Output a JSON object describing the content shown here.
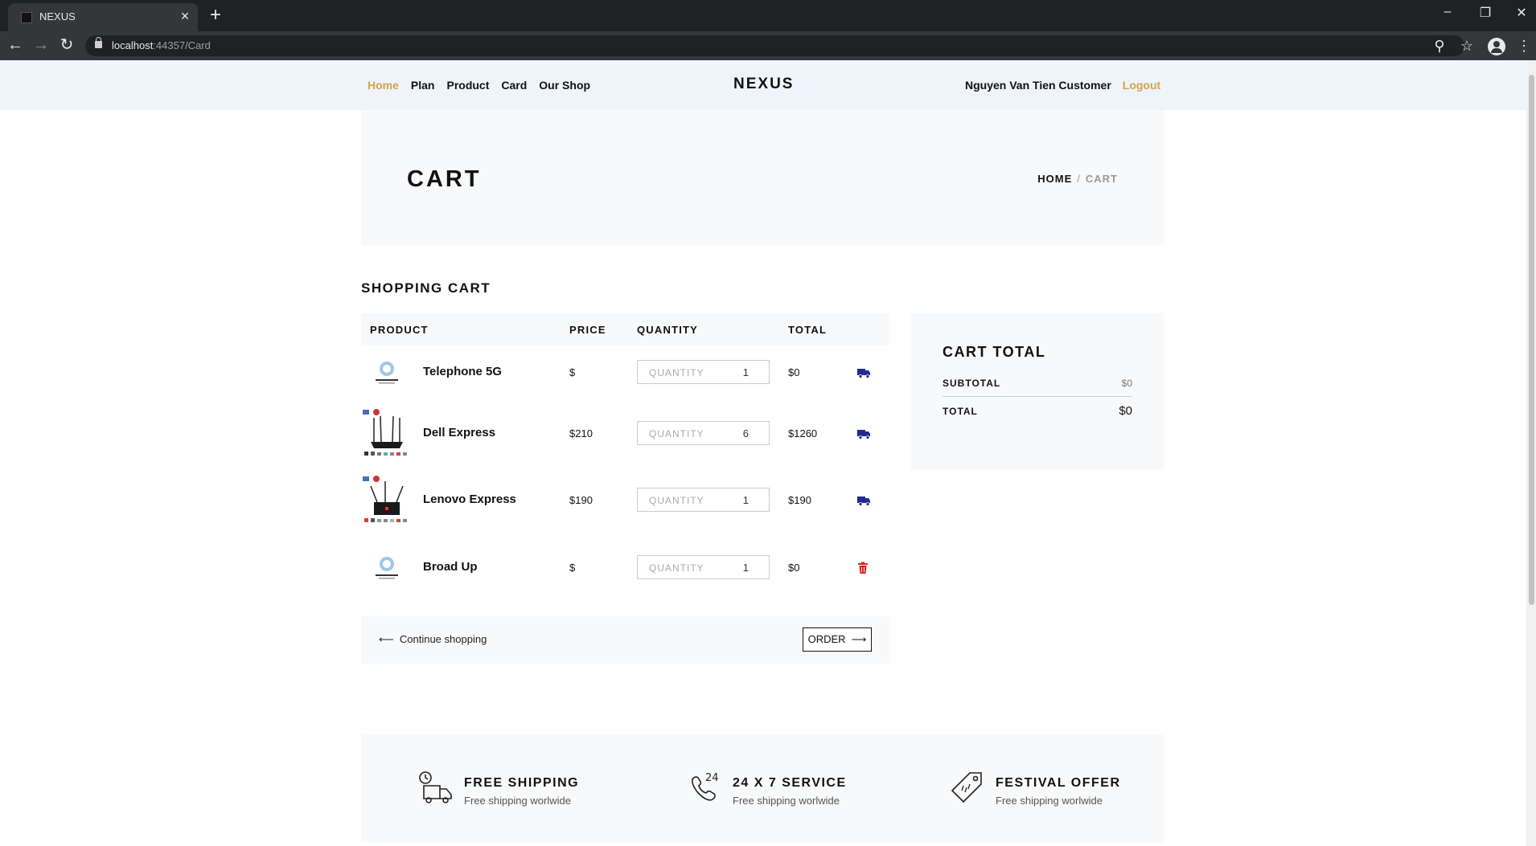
{
  "browser": {
    "tab_title": "NEXUS",
    "url_host": "localhost",
    "url_path": ":44357/Card"
  },
  "nav": {
    "items": [
      "Home",
      "Plan",
      "Product",
      "Card",
      "Our Shop"
    ],
    "logo": "NEXUS",
    "user": "Nguyen Van Tien Customer",
    "logout": "Logout"
  },
  "hero": {
    "title": "CART",
    "breadcrumb_home": "HOME",
    "breadcrumb_sep": "/",
    "breadcrumb_current": "CART"
  },
  "cart": {
    "title": "SHOPPING CART",
    "headers": {
      "product": "PRODUCT",
      "price": "PRICE",
      "quantity": "QUANTITY",
      "total": "TOTAL"
    },
    "qty_placeholder": "QUANTITY",
    "rows": [
      {
        "name": "Telephone 5G",
        "price": "$",
        "qty": "1",
        "total": "$0",
        "action_icon": "truck-icon",
        "image": "logo-thumb"
      },
      {
        "name": "Dell Express",
        "price": "$210",
        "qty": "6",
        "total": "$1260",
        "action_icon": "truck-icon",
        "image": "router-thumb"
      },
      {
        "name": "Lenovo Express",
        "price": "$190",
        "qty": "1",
        "total": "$190",
        "action_icon": "truck-icon",
        "image": "router-thumb"
      },
      {
        "name": "Broad Up",
        "price": "$",
        "qty": "1",
        "total": "$0",
        "action_icon": "trash-icon",
        "image": "logo-thumb"
      }
    ],
    "continue_label": "Continue shopping",
    "order_label": "ORDER"
  },
  "cart_total": {
    "title": "CART TOTAL",
    "subtotal_label": "SUBTOTAL",
    "subtotal_value": "$0",
    "total_label": "TOTAL",
    "total_value": "$0"
  },
  "features": [
    {
      "title": "FREE SHIPPING",
      "subtitle": "Free shipping worlwide",
      "icon": "delivery-truck-icon"
    },
    {
      "title": "24 X 7 SERVICE",
      "subtitle": "Free shipping worlwide",
      "icon": "phone-24-icon"
    },
    {
      "title": "FESTIVAL OFFER",
      "subtitle": "Free shipping worlwide",
      "icon": "price-tag-icon"
    }
  ],
  "colors": {
    "accent": "#d4a44a",
    "header_bg": "#eef4fa",
    "truck_icon": "#1f2b8f",
    "trash_icon": "#e02020"
  }
}
